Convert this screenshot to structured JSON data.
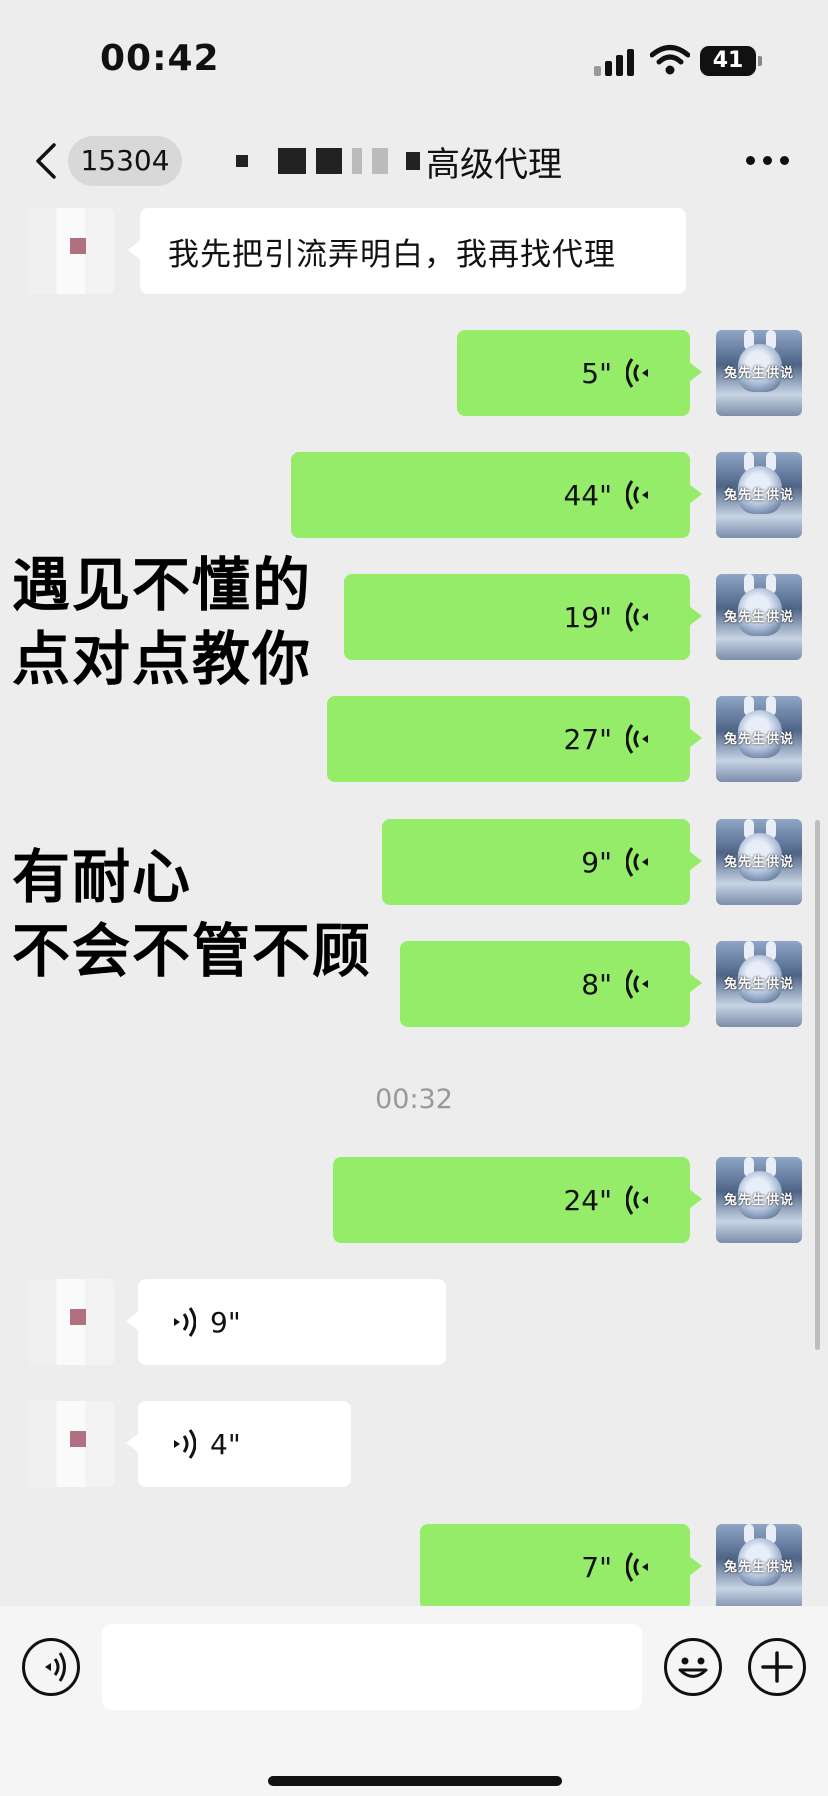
{
  "status_bar": {
    "time": "00:42",
    "battery": "41"
  },
  "nav": {
    "back_count": "15304",
    "title_suffix": "高级代理"
  },
  "messages": [
    {
      "side": "other",
      "kind": "text",
      "text": "我先把引流弄明白，我再找代理"
    },
    {
      "side": "self",
      "kind": "voice",
      "duration": "5\""
    },
    {
      "side": "self",
      "kind": "voice",
      "duration": "44\""
    },
    {
      "side": "self",
      "kind": "voice",
      "duration": "19\""
    },
    {
      "side": "self",
      "kind": "voice",
      "duration": "27\""
    },
    {
      "side": "self",
      "kind": "voice",
      "duration": "9\""
    },
    {
      "side": "self",
      "kind": "voice",
      "duration": "8\""
    },
    {
      "side": "self",
      "kind": "voice",
      "duration": "24\""
    },
    {
      "side": "other",
      "kind": "voice",
      "duration": "9\""
    },
    {
      "side": "other",
      "kind": "voice",
      "duration": "4\""
    },
    {
      "side": "self",
      "kind": "voice",
      "duration": "7\""
    }
  ],
  "timestamp": "00:32",
  "self_avatar_text": "兔先生供说",
  "overlay": {
    "line1": "遇见不懂的",
    "line2": "点对点教你",
    "line3": "有耐心",
    "line4": "不会不管不顾"
  },
  "input": {
    "value": ""
  },
  "icons": {
    "back": "chevron-left-icon",
    "more": "more-icon",
    "voice_toggle": "voice-icon",
    "emoji": "emoji-icon",
    "add": "plus-icon"
  },
  "colors": {
    "self_bubble": "#95ec69",
    "other_bubble": "#ffffff",
    "background": "#ededed"
  }
}
